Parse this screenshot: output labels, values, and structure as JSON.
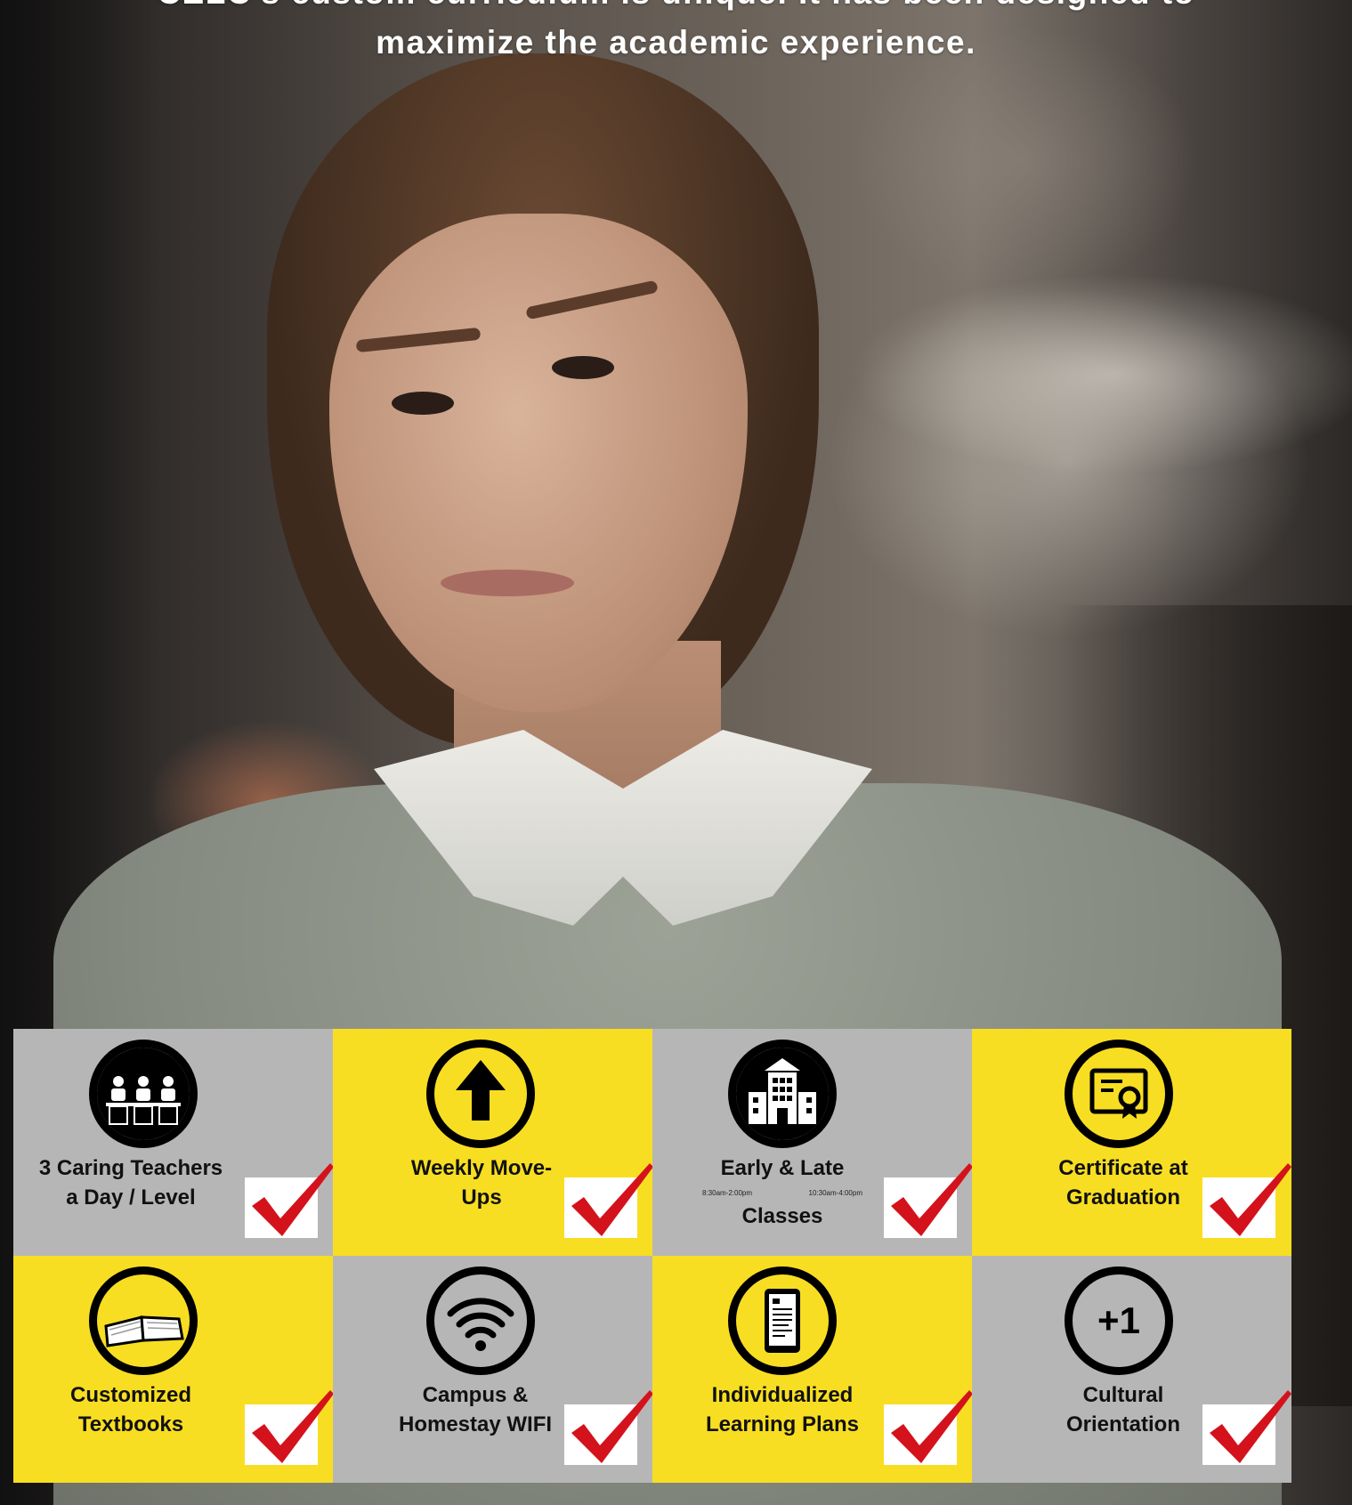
{
  "headline": {
    "line1": "CELC's custom curriculum is unique. It has been designed to",
    "line2": "maximize the academic experience."
  },
  "colors": {
    "tile_gray": "#b7b6b6",
    "tile_yellow": "#f8de22",
    "check_red": "#d4121c",
    "icon_black": "#000000"
  },
  "features": [
    {
      "icon": "teachers-icon",
      "color": "gray",
      "line1": "3 Caring Teachers",
      "line2": "a Day / Level"
    },
    {
      "icon": "arrow-up-icon",
      "color": "yellow",
      "line1": "Weekly Move-",
      "line2": "Ups"
    },
    {
      "icon": "building-icon",
      "color": "gray",
      "line1": "Early & Late",
      "time_early": "8:30am-2:00pm",
      "time_late": "10:30am-4:00pm",
      "line2": "Classes"
    },
    {
      "icon": "certificate-icon",
      "color": "yellow",
      "line1": "Certificate at",
      "line2": "Graduation"
    },
    {
      "icon": "open-book-icon",
      "color": "yellow",
      "line1": "Customized",
      "line2": "Textbooks"
    },
    {
      "icon": "wifi-icon",
      "color": "gray",
      "line1": "Campus &",
      "line2": "Homestay WIFI"
    },
    {
      "icon": "tablet-document-icon",
      "color": "yellow",
      "line1": "Individualized",
      "line2": "Learning Plans"
    },
    {
      "icon": "plus-one-icon",
      "color": "gray",
      "line1": "Cultural",
      "line2": "Orientation",
      "badge": "+1"
    }
  ]
}
